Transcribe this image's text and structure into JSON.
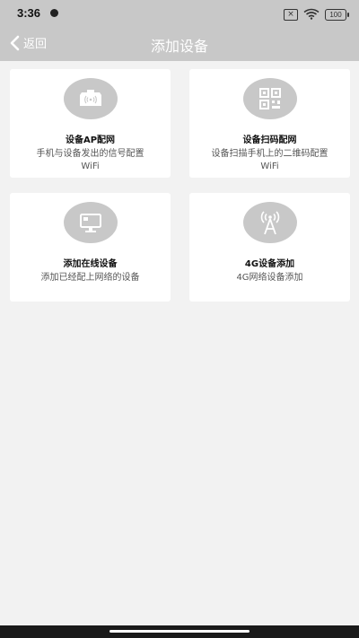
{
  "status_bar": {
    "time": "3:36",
    "sim_glyph": "×",
    "battery": "100"
  },
  "header": {
    "back_label": "返回",
    "title": "添加设备"
  },
  "options": [
    {
      "name": "设备AP配网",
      "desc": "手机与设备发出的信号配置WiFi",
      "icon": "router-icon"
    },
    {
      "name": "设备扫码配网",
      "desc": "设备扫描手机上的二维码配置WiFi",
      "icon": "qr-code-icon"
    },
    {
      "name": "添加在线设备",
      "desc": "添加已经配上网络的设备",
      "icon": "monitor-icon"
    },
    {
      "name": "4G设备添加",
      "desc": "4G网络设备添加",
      "icon": "cell-tower-icon"
    }
  ],
  "colors": {
    "header_bg": "#c8c8c8",
    "page_bg": "#f2f2f2",
    "card_bg": "#ffffff",
    "icon_circle": "#c8c8c8"
  }
}
